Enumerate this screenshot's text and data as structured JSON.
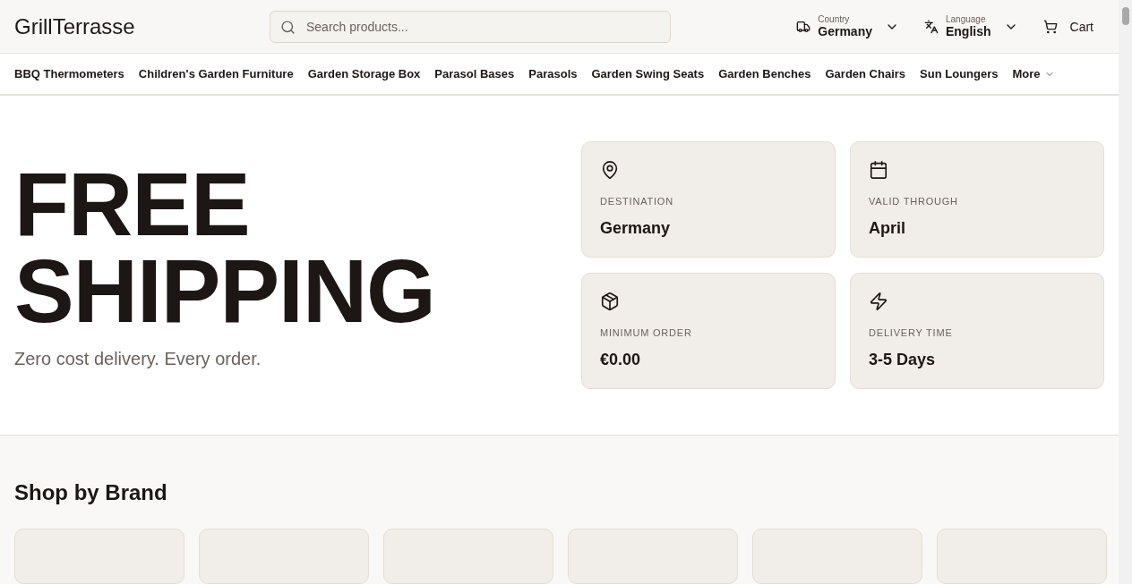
{
  "header": {
    "logo": "GrillTerrasse",
    "search": {
      "placeholder": "Search products..."
    },
    "country": {
      "label": "Country",
      "value": "Germany"
    },
    "language": {
      "label": "Language",
      "value": "English"
    },
    "cart": "Cart"
  },
  "nav": {
    "items": [
      "BBQ Thermometers",
      "Children's Garden Furniture",
      "Garden Storage Box",
      "Parasol Bases",
      "Parasols",
      "Garden Swing Seats",
      "Garden Benches",
      "Garden Chairs",
      "Sun Loungers"
    ],
    "more": "More"
  },
  "hero": {
    "title_lines": [
      "FREE",
      "SHIPPING"
    ],
    "subtitle": "Zero cost delivery. Every order.",
    "cards": [
      {
        "kind": "pin",
        "label": "DESTINATION",
        "value": "Germany"
      },
      {
        "kind": "calendar",
        "label": "VALID THROUGH",
        "value": "April"
      },
      {
        "kind": "box",
        "label": "MINIMUM ORDER",
        "value": "€0.00"
      },
      {
        "kind": "bolt",
        "label": "DELIVERY TIME",
        "value": "3-5 Days"
      }
    ]
  },
  "brands": {
    "title": "Shop by Brand",
    "cards": [
      {
        "kind": "placeholder"
      },
      {
        "kind": "placeholder"
      },
      {
        "kind": "placeholder"
      },
      {
        "kind": "placeholder"
      },
      {
        "kind": "placeholder"
      },
      {
        "kind": "placeholder"
      }
    ]
  }
}
